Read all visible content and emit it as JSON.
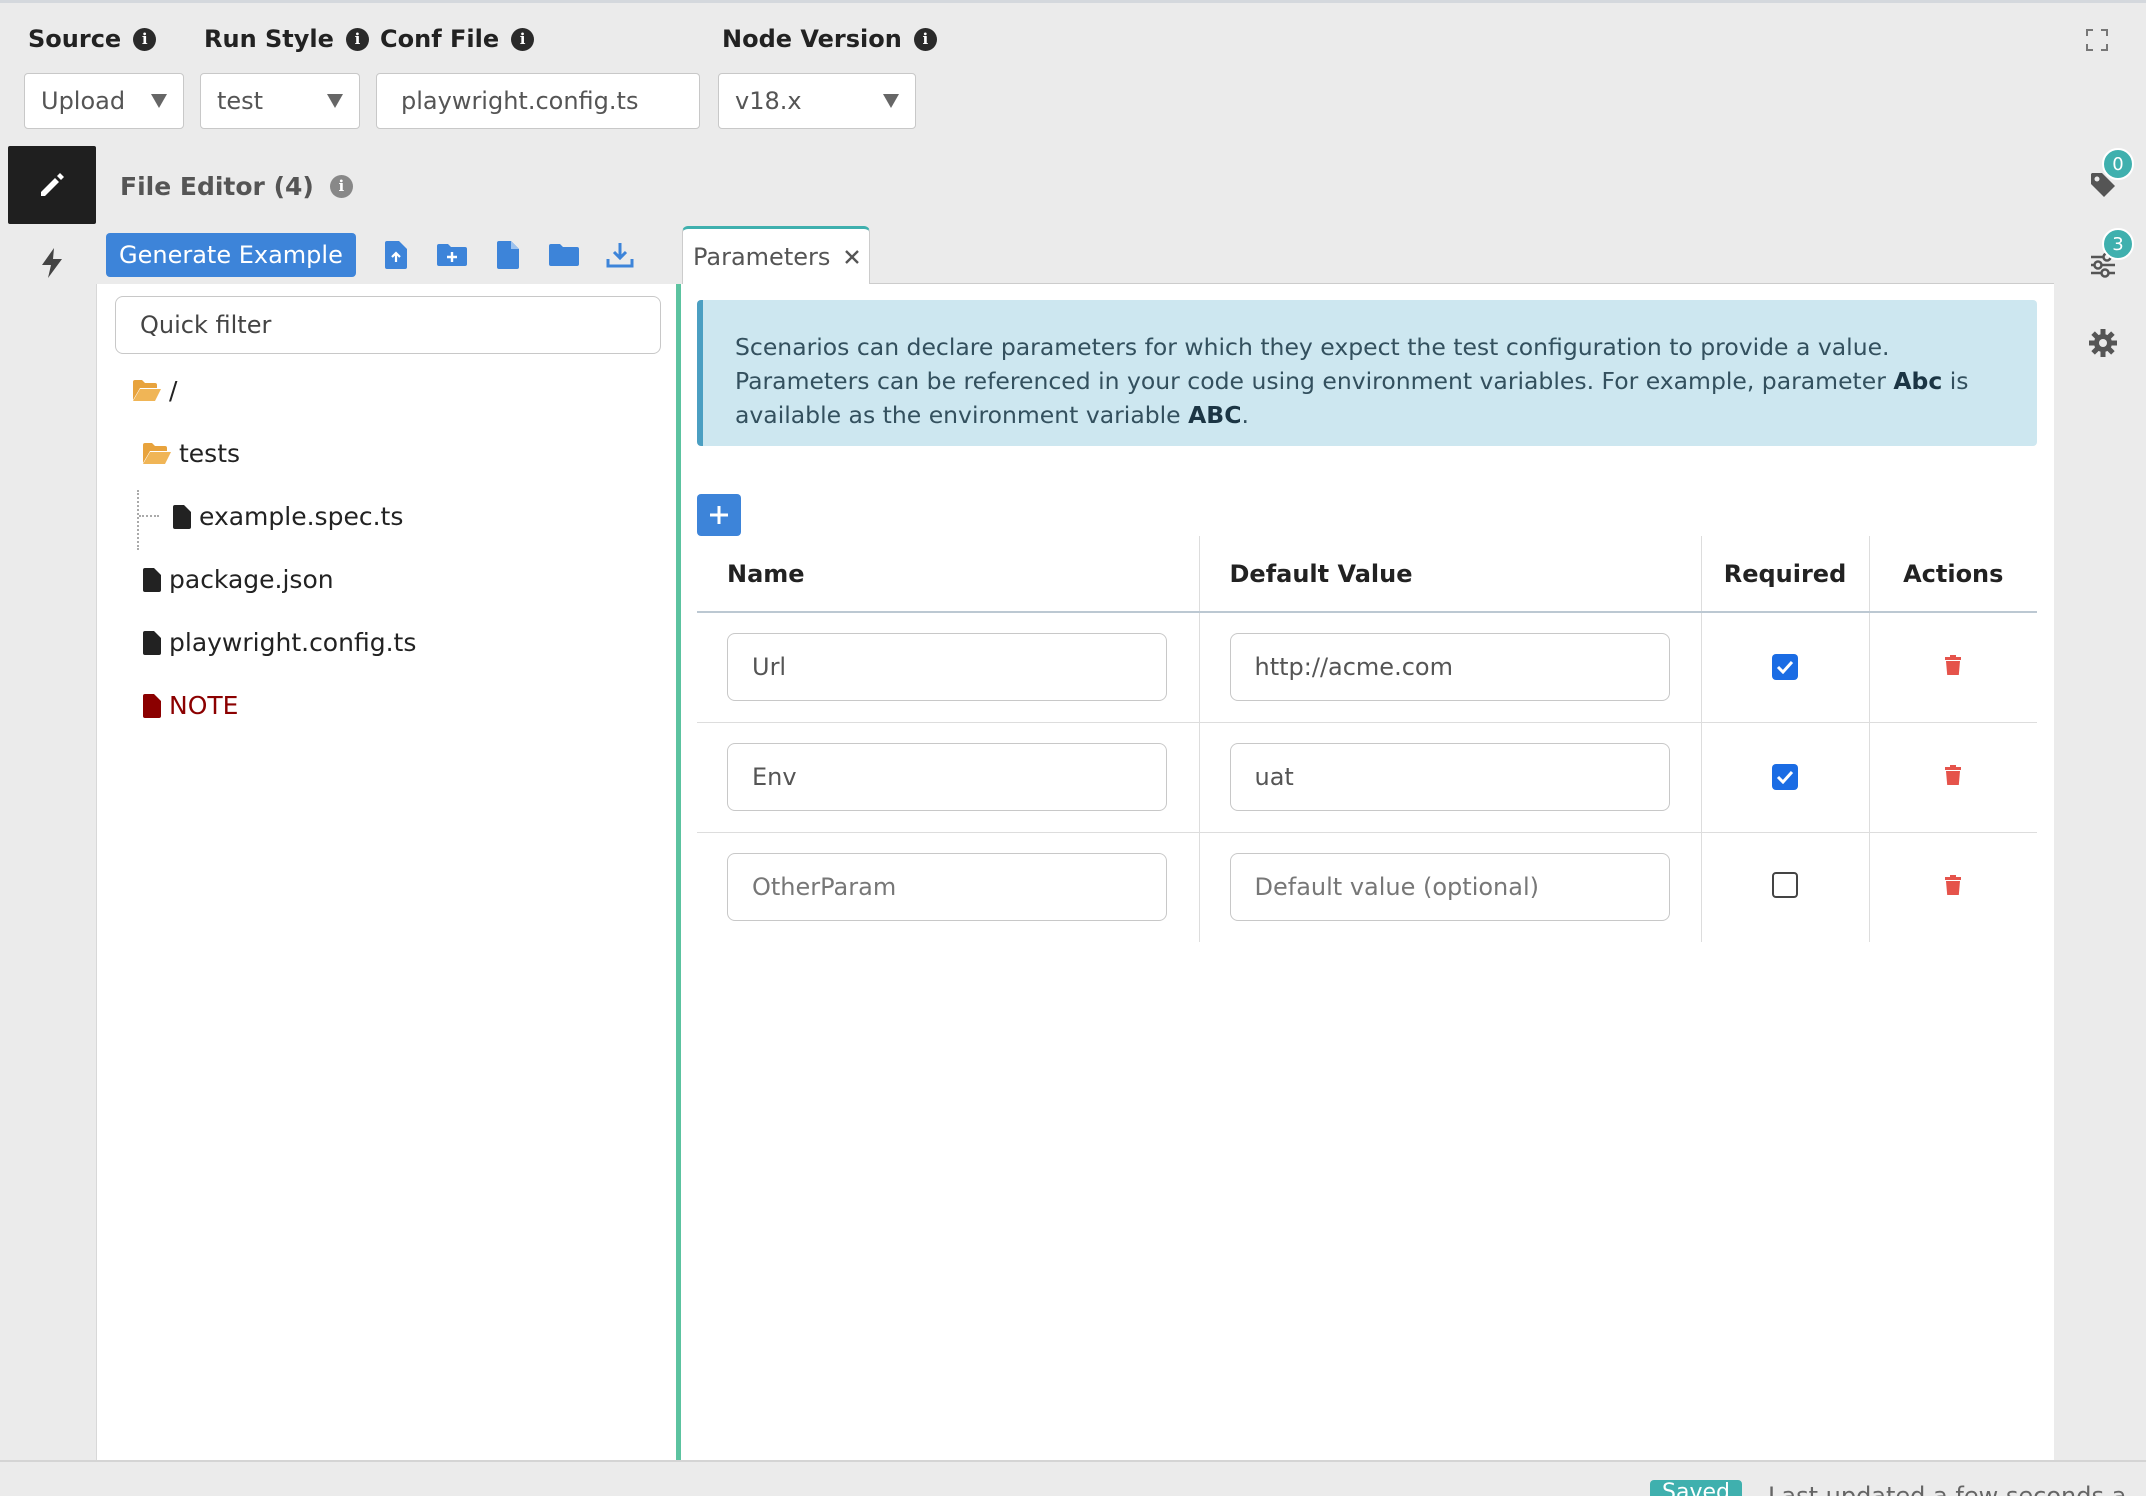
{
  "settings": {
    "source": {
      "label": "Source",
      "value": "Upload"
    },
    "run_style": {
      "label": "Run Style",
      "value": "test"
    },
    "conf_file": {
      "label": "Conf File",
      "value": "playwright.config.ts"
    },
    "node_version": {
      "label": "Node Version",
      "value": "v18.x"
    },
    "info_glyph": "i"
  },
  "editor": {
    "title": "File Editor (4)",
    "generate_label": "Generate Example",
    "toolbar_icons": [
      "upload-file-icon",
      "new-folder-icon",
      "new-file-icon",
      "folder-icon",
      "download-icon"
    ]
  },
  "tree": {
    "filter_placeholder": "Quick filter",
    "root": "/",
    "items": [
      {
        "name": "tests",
        "type": "folder"
      },
      {
        "name": "example.spec.ts",
        "type": "file"
      },
      {
        "name": "package.json",
        "type": "file"
      },
      {
        "name": "playwright.config.ts",
        "type": "file"
      },
      {
        "name": "NOTE",
        "type": "file",
        "color": "#8b0000"
      }
    ]
  },
  "tab": {
    "label": "Parameters"
  },
  "alert": {
    "text_1": "Scenarios can declare parameters for which they expect the test configuration to provide a value. Parameters can be referenced in your code using environment variables. For example, parameter ",
    "bold_1": "Abc",
    "text_2": " is available as the environment variable ",
    "bold_2": "ABC",
    "text_3": "."
  },
  "table": {
    "headers": [
      "Name",
      "Default Value",
      "Required",
      "Actions"
    ],
    "rows": [
      {
        "name": "Url",
        "default": "http://acme.com",
        "required": true
      },
      {
        "name": "Env",
        "default": "uat",
        "required": true
      },
      {
        "name": "",
        "name_placeholder": "OtherParam",
        "default": "",
        "default_placeholder": "Default value (optional)",
        "required": false
      }
    ]
  },
  "right_rail": {
    "tags_badge": "0",
    "filters_badge": "3"
  },
  "status": {
    "save_label": "Saved",
    "updated_text": "Last updated a few seconds a"
  },
  "colors": {
    "primary": "#3d84d9",
    "accent": "#3fb0ae",
    "danger": "#e5534b",
    "alert_bg": "#cde7f0"
  }
}
